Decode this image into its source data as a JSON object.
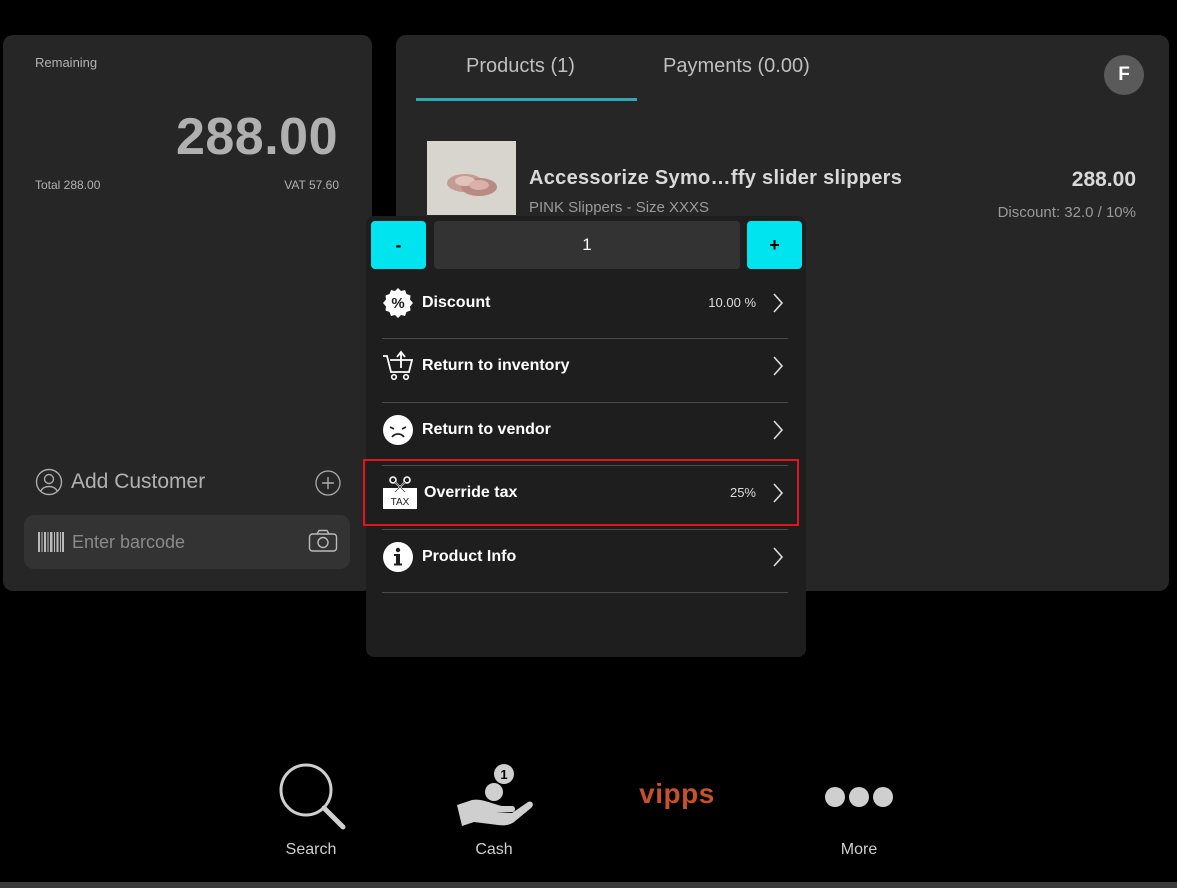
{
  "left": {
    "remaining_label": "Remaining",
    "remaining_amount": "288.00",
    "total_label": "Total 288.00",
    "vat_label": "VAT 57.60",
    "add_customer_label": "Add Customer",
    "barcode_placeholder": "Enter barcode"
  },
  "right": {
    "tabs": [
      {
        "label": "Products (1)"
      },
      {
        "label": "Payments (0.00)"
      }
    ],
    "avatar_initial": "F",
    "product": {
      "name": "Accessorize Symo…ffy slider slippers",
      "variant": "PINK Slippers - Size XXXS",
      "price": "288.00",
      "discount": "Discount: 32.0 / 10%"
    }
  },
  "popup": {
    "minus_label": "-",
    "plus_label": "+",
    "quantity": "1",
    "items": [
      {
        "label": "Discount",
        "value": "10.00 %",
        "icon": "percent-badge-icon"
      },
      {
        "label": "Return to inventory",
        "value": "",
        "icon": "cart-return-icon"
      },
      {
        "label": "Return to vendor",
        "value": "",
        "icon": "sad-face-icon"
      },
      {
        "label": "Override tax",
        "value": "25%",
        "icon": "tax-cut-icon",
        "icon_text": "TAX"
      },
      {
        "label": "Product Info",
        "value": "",
        "icon": "info-icon"
      }
    ]
  },
  "bottom": {
    "search_label": "Search",
    "cash_label": "Cash",
    "vipps_label": "vipps",
    "more_label": "More"
  },
  "colors": {
    "accent_cyan": "#00e4f0",
    "tab_underline": "#2fa8b4",
    "highlight_red": "#e0151d",
    "vipps_orange": "#c8502a"
  }
}
